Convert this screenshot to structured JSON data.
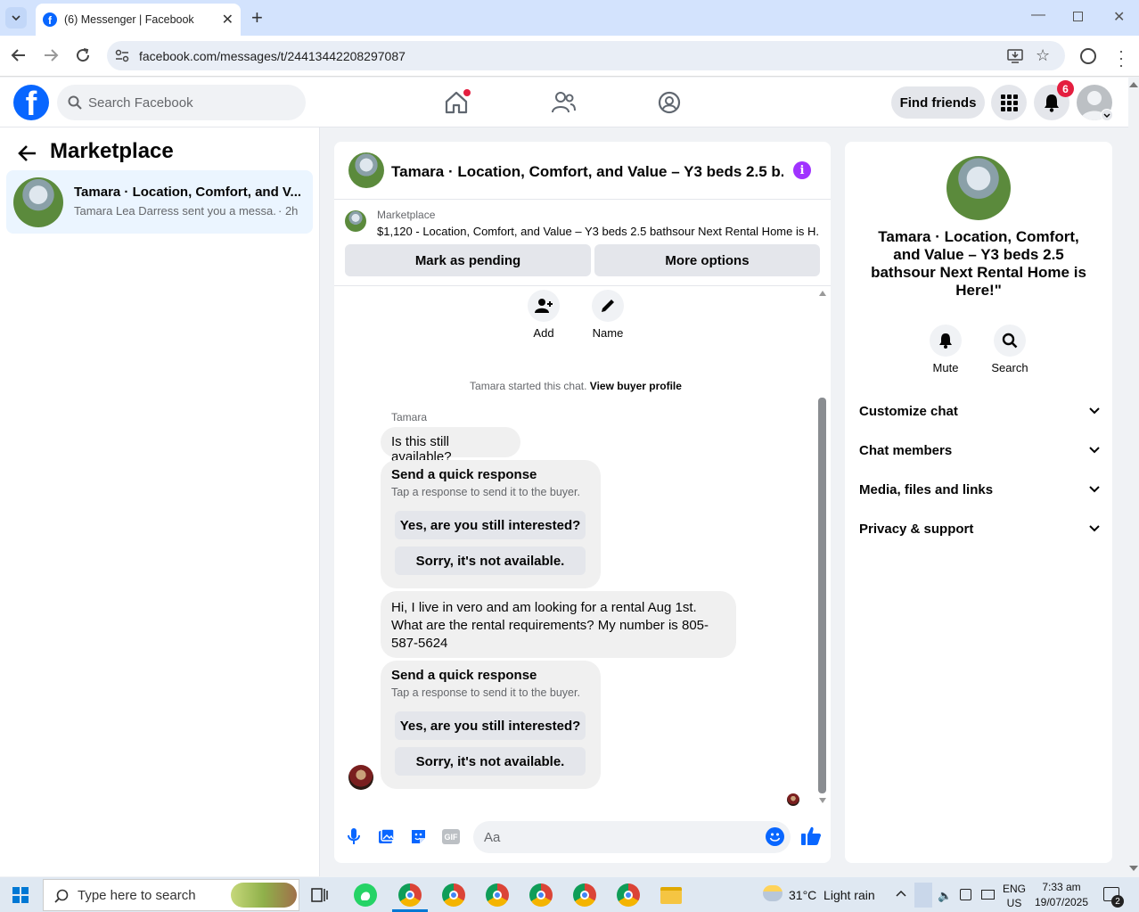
{
  "browser": {
    "tab_title": "(6) Messenger | Facebook",
    "url": "facebook.com/messages/t/24413442208297087"
  },
  "fb_header": {
    "search_placeholder": "Search Facebook",
    "find_friends_label": "Find friends",
    "notification_count": "6"
  },
  "sidebar": {
    "title": "Marketplace",
    "conversation": {
      "title": "Tamara · Location, Comfort, and V...",
      "preview": "Tamara Lea Darress sent you a messa...",
      "time": "· 2h"
    }
  },
  "chat": {
    "header_title": "Tamara · Location, Comfort, and Value – Y3 beds 2.5 b...",
    "listing": {
      "label": "Marketplace",
      "description": "$1,120 - Location, Comfort, and Value – Y3 beds 2.5 bathsour Next Rental Home is H..."
    },
    "mark_pending_label": "Mark as pending",
    "more_options_label": "More options",
    "add_label": "Add",
    "name_label": "Name",
    "started_text": "Tamara started this chat.",
    "view_buyer_label": "View buyer profile",
    "sender_name": "Tamara",
    "message_1": "Is this still available?",
    "quick_response_1": {
      "title": "Send a quick response",
      "subtitle": "Tap a response to send it to the buyer.",
      "option_1": "Yes, are you still interested?",
      "option_2": "Sorry, it's not available."
    },
    "message_2": "Hi, I live in vero and am looking for a rental Aug 1st. What are the rental requirements? My number is 805-587-5624",
    "quick_response_2": {
      "title": "Send a quick response",
      "subtitle": "Tap a response to send it to the buyer.",
      "option_1": "Yes, are you still interested?",
      "option_2": "Sorry, it's not available."
    },
    "composer_placeholder": "Aa"
  },
  "details": {
    "title": "Tamara · Location, Comfort, and Value – Y3 beds 2.5 bathsour Next Rental Home is Here!\"",
    "mute_label": "Mute",
    "search_label": "Search",
    "sections": [
      "Customize chat",
      "Chat members",
      "Media, files and links",
      "Privacy & support"
    ]
  },
  "taskbar": {
    "search_placeholder": "Type here to search",
    "weather": "31°C  Light rain",
    "lang_1": "ENG",
    "lang_2": "US",
    "time": "7:33 am",
    "date": "19/07/2025",
    "notification_count": "2"
  },
  "colors": {
    "fb_blue": "#0866ff",
    "accent_purple": "#a033ff",
    "badge_red": "#e41e3f"
  }
}
